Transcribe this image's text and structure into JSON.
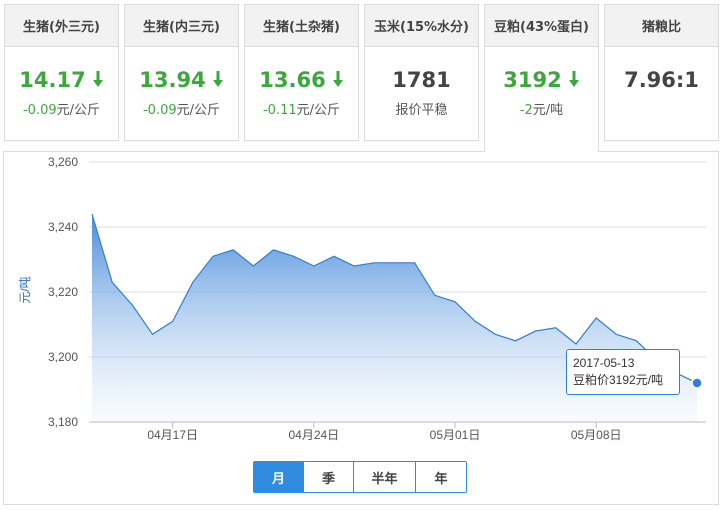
{
  "cards": [
    {
      "title": "生猪(外三元)",
      "price": "14.17",
      "trend": "down",
      "change": "-0.09",
      "unit": "元/公斤"
    },
    {
      "title": "生猪(内三元)",
      "price": "13.94",
      "trend": "down",
      "change": "-0.09",
      "unit": "元/公斤"
    },
    {
      "title": "生猪(土杂猪)",
      "price": "13.66",
      "trend": "down",
      "change": "-0.11",
      "unit": "元/公斤"
    },
    {
      "title": "玉米(15%水分)",
      "price": "1781",
      "trend": "flat",
      "change": "报价平稳",
      "unit": ""
    },
    {
      "title": "豆粕(43%蛋白)",
      "price": "3192",
      "trend": "down",
      "change": "-2",
      "unit": "元/吨"
    },
    {
      "title": "猪粮比",
      "price": "7.96:1",
      "trend": "none",
      "change": "",
      "unit": ""
    }
  ],
  "active_card": 4,
  "range_tabs": [
    "月",
    "季",
    "半年",
    "年"
  ],
  "range_selected": 0,
  "tooltip": {
    "date": "2017-05-13",
    "text": "豆粕价3192元/吨"
  },
  "colors": {
    "accent": "#2f8ce0",
    "down": "#3aa83c",
    "area_top": "#3f86d8",
    "area_bottom": "#ffffff"
  },
  "chart_data": {
    "type": "area",
    "ylabel": "元/吨",
    "xlabel": "",
    "ylim": [
      3180,
      3260
    ],
    "yticks": [
      3180,
      3200,
      3220,
      3240,
      3260
    ],
    "xticks": [
      "04月17日",
      "04月24日",
      "05月01日",
      "05月08日"
    ],
    "grid": true,
    "x": [
      "2017-04-13",
      "2017-04-14",
      "2017-04-15",
      "2017-04-16",
      "2017-04-17",
      "2017-04-18",
      "2017-04-19",
      "2017-04-20",
      "2017-04-21",
      "2017-04-22",
      "2017-04-23",
      "2017-04-24",
      "2017-04-25",
      "2017-04-26",
      "2017-04-27",
      "2017-04-28",
      "2017-04-29",
      "2017-04-30",
      "2017-05-01",
      "2017-05-02",
      "2017-05-03",
      "2017-05-04",
      "2017-05-05",
      "2017-05-06",
      "2017-05-07",
      "2017-05-08",
      "2017-05-09",
      "2017-05-10",
      "2017-05-11",
      "2017-05-12",
      "2017-05-13"
    ],
    "series": [
      {
        "values": [
          3244,
          3223,
          3216,
          3207,
          3211,
          3223,
          3231,
          3233,
          3228,
          3233,
          3231,
          3228,
          3231,
          3228,
          3229,
          3229,
          3229,
          3219,
          3217,
          3211,
          3207,
          3205,
          3208,
          3209,
          3204,
          3212,
          3207,
          3205,
          3199,
          3195,
          3192
        ]
      }
    ],
    "highlight_index": 30
  }
}
